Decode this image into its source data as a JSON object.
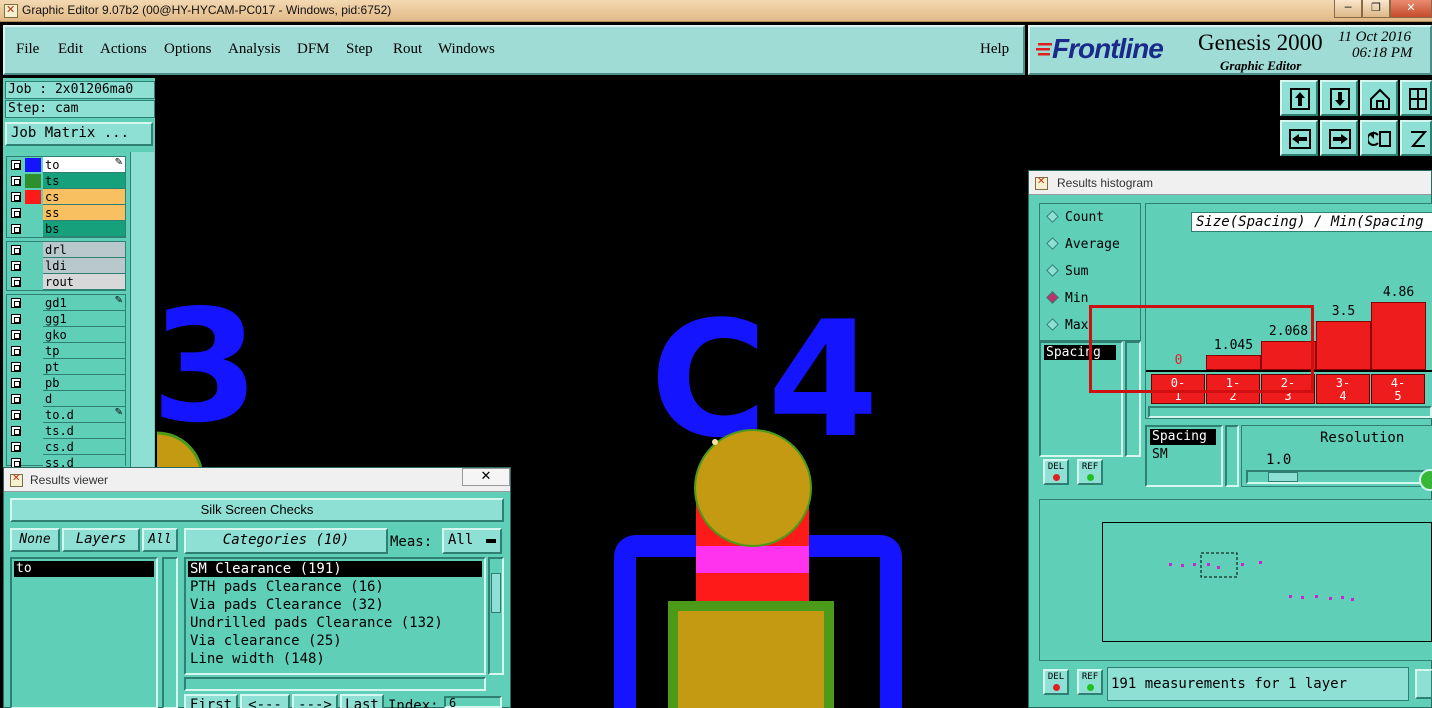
{
  "window": {
    "title": "Graphic Editor 9.07b2 (00@HY-HYCAM-PC017 - Windows, pid:6752)",
    "buttons": [
      "─",
      "❐",
      "✕"
    ]
  },
  "menu": {
    "items": [
      "File",
      "Edit",
      "Actions",
      "Options",
      "Analysis",
      "DFM",
      "Step",
      "Rout",
      "Windows"
    ],
    "help": "Help"
  },
  "brand": {
    "logo": "Frontline",
    "product": "Genesis 2000",
    "subtitle": "Graphic Editor",
    "date": "11 Oct 2016",
    "time": "06:18 PM"
  },
  "left": {
    "job": "Job : 2x01206ma0",
    "step": "Step: cam",
    "job_matrix": "Job Matrix ...",
    "layers_a": [
      {
        "name": "to",
        "color": "#1414ff",
        "bg": "#ffffff",
        "mark": "✎"
      },
      {
        "name": "ts",
        "color": "#2f8f2f",
        "bg": "#17a07c",
        "mark": ""
      },
      {
        "name": "cs",
        "color": "#ff1a1a",
        "bg": "#f8c060",
        "mark": ""
      },
      {
        "name": "ss",
        "color": "#5fcfb8",
        "bg": "#f8c060",
        "mark": ""
      },
      {
        "name": "bs",
        "color": "#5fcfb8",
        "bg": "#17a07c",
        "mark": ""
      }
    ],
    "layers_b": [
      {
        "name": "drl",
        "bg": "#b8c8cc"
      },
      {
        "name": "ldi",
        "bg": "#b8c8cc"
      },
      {
        "name": "rout",
        "bg": "#d8d8d8"
      }
    ],
    "layers_c": [
      {
        "name": "gd1",
        "mark": "✎"
      },
      {
        "name": "gg1",
        "mark": ""
      },
      {
        "name": "gko",
        "mark": ""
      },
      {
        "name": "tp",
        "mark": ""
      },
      {
        "name": "pt",
        "mark": ""
      },
      {
        "name": "pb",
        "mark": ""
      },
      {
        "name": "d",
        "mark": ""
      },
      {
        "name": "to.d",
        "mark": "✎"
      },
      {
        "name": "ts.d",
        "mark": ""
      },
      {
        "name": "cs.d",
        "mark": ""
      },
      {
        "name": "ss.d",
        "mark": ""
      }
    ]
  },
  "canvas": {
    "label_left": "3",
    "label_main": "C4"
  },
  "results_viewer": {
    "title": "Results viewer",
    "close": "✕",
    "heading": "Silk Screen Checks",
    "none_btn": "None",
    "layers_btn": "Layers",
    "all_btn": "All",
    "categories_btn": "Categories (10)",
    "meas_label": "Meas:",
    "meas_value": "All",
    "layer_list": [
      "to"
    ],
    "categories": [
      "SM Clearance (191)",
      "PTH pads Clearance (16)",
      "Via pads Clearance (32)",
      "Undrilled pads Clearance (132)",
      "Via clearance (25)",
      "Line width (148)"
    ],
    "nav": [
      "First",
      "<---",
      "--->",
      "Last"
    ],
    "index_label": "Index:",
    "index_value": "6"
  },
  "histogram": {
    "title": "Results histogram",
    "modes": [
      "Count",
      "Average",
      "Sum",
      "Min",
      "Max"
    ],
    "selected_mode": "Min",
    "chart_title": "Size(Spacing) / Min(Spacing",
    "list_item": "Spacing",
    "bars": [
      {
        "label": "0",
        "value": 0,
        "bin": "0-\n1"
      },
      {
        "label": "1.045",
        "value": 1.045,
        "bin": "1-\n2"
      },
      {
        "label": "2.068",
        "value": 2.068,
        "bin": "2-\n3"
      },
      {
        "label": "3.5",
        "value": 3.5,
        "bin": "3-\n4"
      },
      {
        "label": "4.86",
        "value": 4.86,
        "bin": "4-\n5"
      }
    ],
    "attr_list": [
      "Spacing",
      "SM"
    ],
    "resolution_label": "Resolution",
    "resolution_value": "1.0",
    "del": "DEL",
    "ref": "REF",
    "status": "191 measurements for 1 layer"
  },
  "chart_data": {
    "type": "bar",
    "title": "Size(Spacing) / Min(Spacing",
    "categories": [
      "0-1",
      "1-2",
      "2-3",
      "3-4",
      "4-5"
    ],
    "values": [
      0,
      1.045,
      2.068,
      3.5,
      4.86
    ],
    "xlabel": "",
    "ylabel": ""
  },
  "colors": {
    "teal": "#5fcfb8",
    "teal_light": "#8fe0d4",
    "silk_blue": "#1414ff",
    "pad_gold": "#c39a12",
    "pad_red": "#ff1a1a",
    "pad_green": "#4b9a1a",
    "overlap_magenta": "#ff33ee",
    "highlight_box": "#d01010"
  }
}
